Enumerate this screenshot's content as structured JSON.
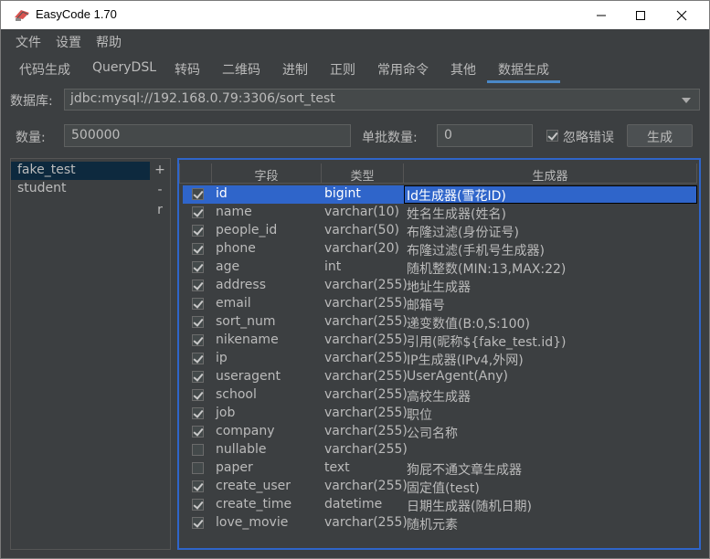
{
  "app": {
    "title": "EasyCode 1.70"
  },
  "menu": [
    "文件",
    "设置",
    "帮助"
  ],
  "tabs": [
    "代码生成",
    "QueryDSL",
    "转码",
    "二维码",
    "进制",
    "正则",
    "常用命令",
    "其他",
    "数据生成"
  ],
  "active_tab": "数据生成",
  "database": {
    "label": "数据库:",
    "value": "jdbc:mysql://192.168.0.79:3306/sort_test"
  },
  "quantity": {
    "label": "数量:",
    "value": "500000"
  },
  "batch": {
    "label": "单批数量:",
    "value": "0"
  },
  "ignore_errors": {
    "label": "忽略错误",
    "checked": true
  },
  "generate_button": "生成",
  "tables": [
    "fake_test",
    "student"
  ],
  "side_buttons": [
    "+",
    "-",
    "r"
  ],
  "grid": {
    "headers": [
      "字段",
      "类型",
      "生成器"
    ],
    "rows": [
      {
        "checked": true,
        "field": "id",
        "type": "bigint",
        "generator": "Id生成器(雪花ID)"
      },
      {
        "checked": true,
        "field": "name",
        "type": "varchar(10)",
        "generator": "姓名生成器(姓名)"
      },
      {
        "checked": true,
        "field": "people_id",
        "type": "varchar(50)",
        "generator": "布隆过滤(身份证号)"
      },
      {
        "checked": true,
        "field": "phone",
        "type": "varchar(20)",
        "generator": "布隆过滤(手机号生成器)"
      },
      {
        "checked": true,
        "field": "age",
        "type": "int",
        "generator": "随机整数(MIN:13,MAX:22)"
      },
      {
        "checked": true,
        "field": "address",
        "type": "varchar(255)",
        "generator": "地址生成器"
      },
      {
        "checked": true,
        "field": "email",
        "type": "varchar(255)",
        "generator": "邮箱号"
      },
      {
        "checked": true,
        "field": "sort_num",
        "type": "varchar(255)",
        "generator": "递变数值(B:0,S:100)"
      },
      {
        "checked": true,
        "field": "nikename",
        "type": "varchar(255)",
        "generator": "引用(昵称${fake_test.id})"
      },
      {
        "checked": true,
        "field": "ip",
        "type": "varchar(255)",
        "generator": "IP生成器(IPv4,外网)"
      },
      {
        "checked": true,
        "field": "useragent",
        "type": "varchar(255)",
        "generator": "UserAgent(Any)"
      },
      {
        "checked": true,
        "field": "school",
        "type": "varchar(255)",
        "generator": "高校生成器"
      },
      {
        "checked": true,
        "field": "job",
        "type": "varchar(255)",
        "generator": "职位"
      },
      {
        "checked": true,
        "field": "company",
        "type": "varchar(255)",
        "generator": "公司名称"
      },
      {
        "checked": false,
        "field": "nullable",
        "type": "varchar(255)",
        "generator": ""
      },
      {
        "checked": false,
        "field": "paper",
        "type": "text",
        "generator": "狗屁不通文章生成器"
      },
      {
        "checked": true,
        "field": "create_user",
        "type": "varchar(255)",
        "generator": "固定值(test)"
      },
      {
        "checked": true,
        "field": "create_time",
        "type": "datetime",
        "generator": "日期生成器(随机日期)"
      },
      {
        "checked": true,
        "field": "love_movie",
        "type": "varchar(255)",
        "generator": "随机元素"
      }
    ]
  },
  "colors": {
    "accent": "#2f65ca",
    "background": "#3c3f41",
    "text": "#bbbbbb"
  }
}
